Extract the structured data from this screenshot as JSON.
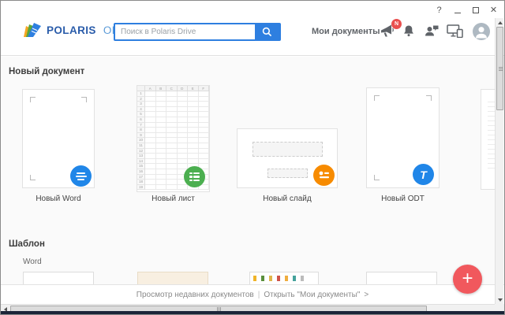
{
  "window": {
    "controls": {
      "help": "?",
      "close": "✕"
    }
  },
  "header": {
    "logo_text_primary": "POLARIS",
    "logo_text_secondary": "OFFICE",
    "search_placeholder": "Поиск в Polaris Drive",
    "my_documents_label": "Мои документы",
    "notification_badge": "N"
  },
  "new_document": {
    "title": "Новый документ",
    "cards": [
      {
        "label": "Новый Word"
      },
      {
        "label": "Новый лист"
      },
      {
        "label": "Новый слайд"
      },
      {
        "label": "Новый ODT"
      }
    ],
    "odt_glyph": "T",
    "sheet": {
      "columns": [
        "A",
        "B",
        "C",
        "D",
        "E",
        "F"
      ],
      "row_count": 19
    }
  },
  "template_section": {
    "title": "Шаблон",
    "category": "Word",
    "decor_icon_colors": [
      "#f0b429",
      "#5a8f3c",
      "#e0b64a",
      "#cf5349",
      "#efad3f",
      "#45a29b",
      "#bcbcbc"
    ]
  },
  "footer": {
    "recent_label": "Просмотр недавних документов",
    "separator": "|",
    "open_label": "Открыть \"Мои документы\"",
    "chevron": ">"
  },
  "fab_label": "+",
  "colors": {
    "accent_blue": "#2e7fe0",
    "doc_blue": "#2086e8",
    "sheet_green": "#4caf50",
    "slide_orange": "#f78b00",
    "fab_red": "#f1585d",
    "badge_red": "#e94f4e",
    "content_bg": "#fafafa"
  }
}
